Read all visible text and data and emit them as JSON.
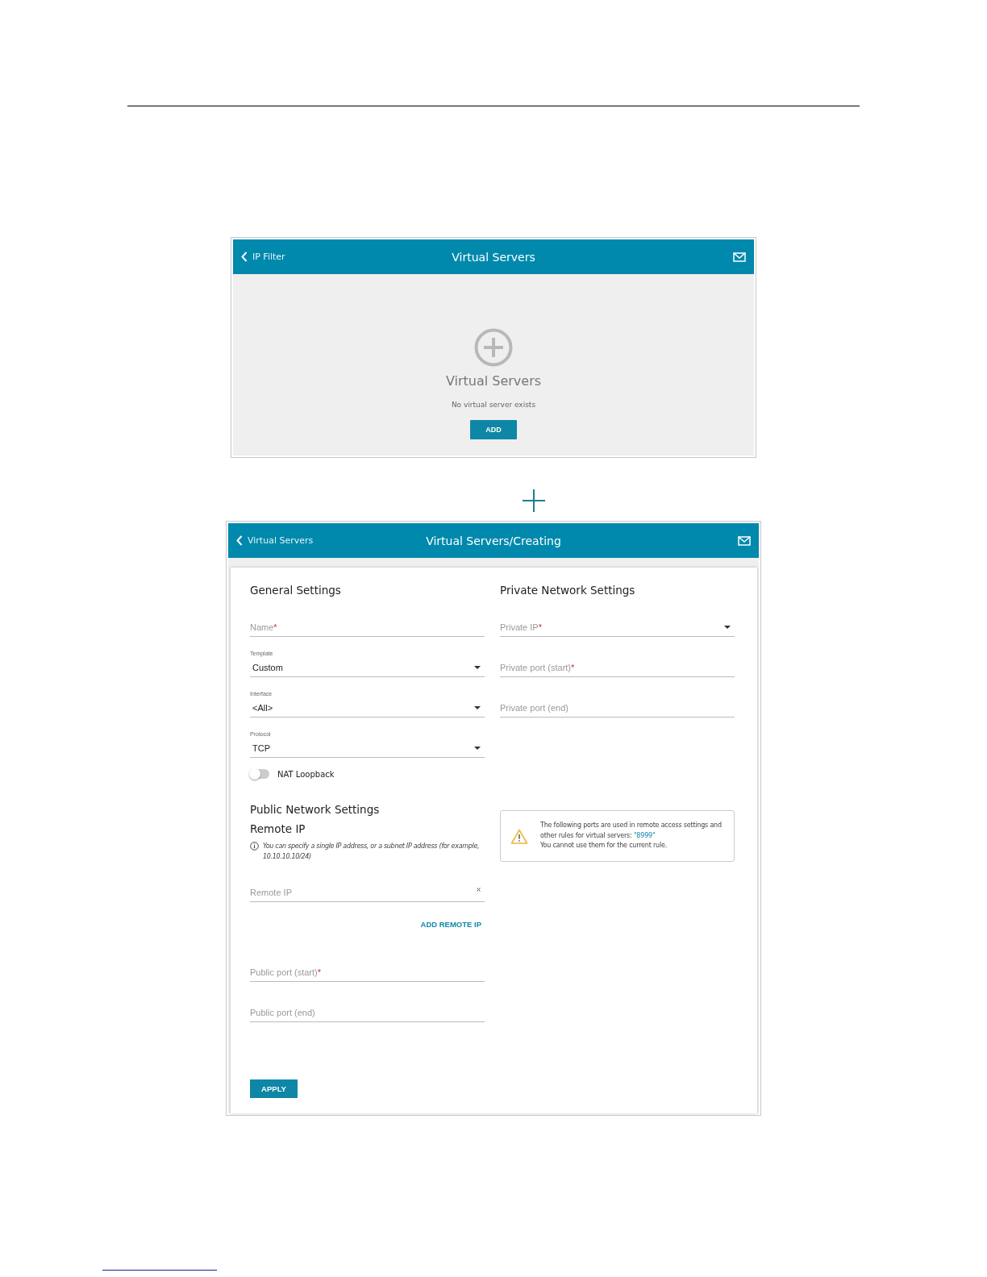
{
  "list_screen": {
    "header": {
      "back": "IP Filter",
      "title": "Virtual Servers"
    },
    "empty": {
      "title": "Virtual Servers",
      "message": "No virtual server exists",
      "button": "ADD"
    }
  },
  "create_screen": {
    "header": {
      "back": "Virtual Servers",
      "title": "Virtual Servers/Creating"
    },
    "general": {
      "title": "General Settings",
      "fields": [
        {
          "kind": "text",
          "placeholder": "Name",
          "mark": "*"
        },
        {
          "kind": "select",
          "caption": "Template",
          "value": "Custom"
        },
        {
          "kind": "select",
          "caption": "Interface",
          "value": "<All>"
        },
        {
          "kind": "select",
          "caption": "Protocol",
          "value": "TCP"
        }
      ],
      "toggle": {
        "label": "NAT Loopback",
        "on": false
      }
    },
    "public": {
      "title": "Public Network Settings",
      "subtitle": "Remote IP",
      "hint": "You can specify a single IP address, or a subnet IP address (for example, 10.10.10.10/24)",
      "remote_field": {
        "kind": "clearable",
        "placeholder": "Remote IP"
      },
      "add_link": "ADD REMOTE IP",
      "fields": [
        {
          "kind": "text",
          "placeholder": "Public port (start)",
          "mark": "*"
        },
        {
          "kind": "text",
          "placeholder": "Public port (end)"
        }
      ]
    },
    "private": {
      "title": "Private Network Settings",
      "fields": [
        {
          "kind": "select-empty",
          "placeholder": "Private IP",
          "mark": "*"
        },
        {
          "kind": "text",
          "placeholder": "Private port (start)",
          "mark": "*"
        },
        {
          "kind": "text",
          "placeholder": "Private port (end)"
        }
      ]
    },
    "notice": {
      "text": "The following ports are used in remote access settings and other rules for virtual servers:",
      "ports": "\"8999\"",
      "note": "You cannot use them for the current rule."
    },
    "apply": "APPLY"
  }
}
